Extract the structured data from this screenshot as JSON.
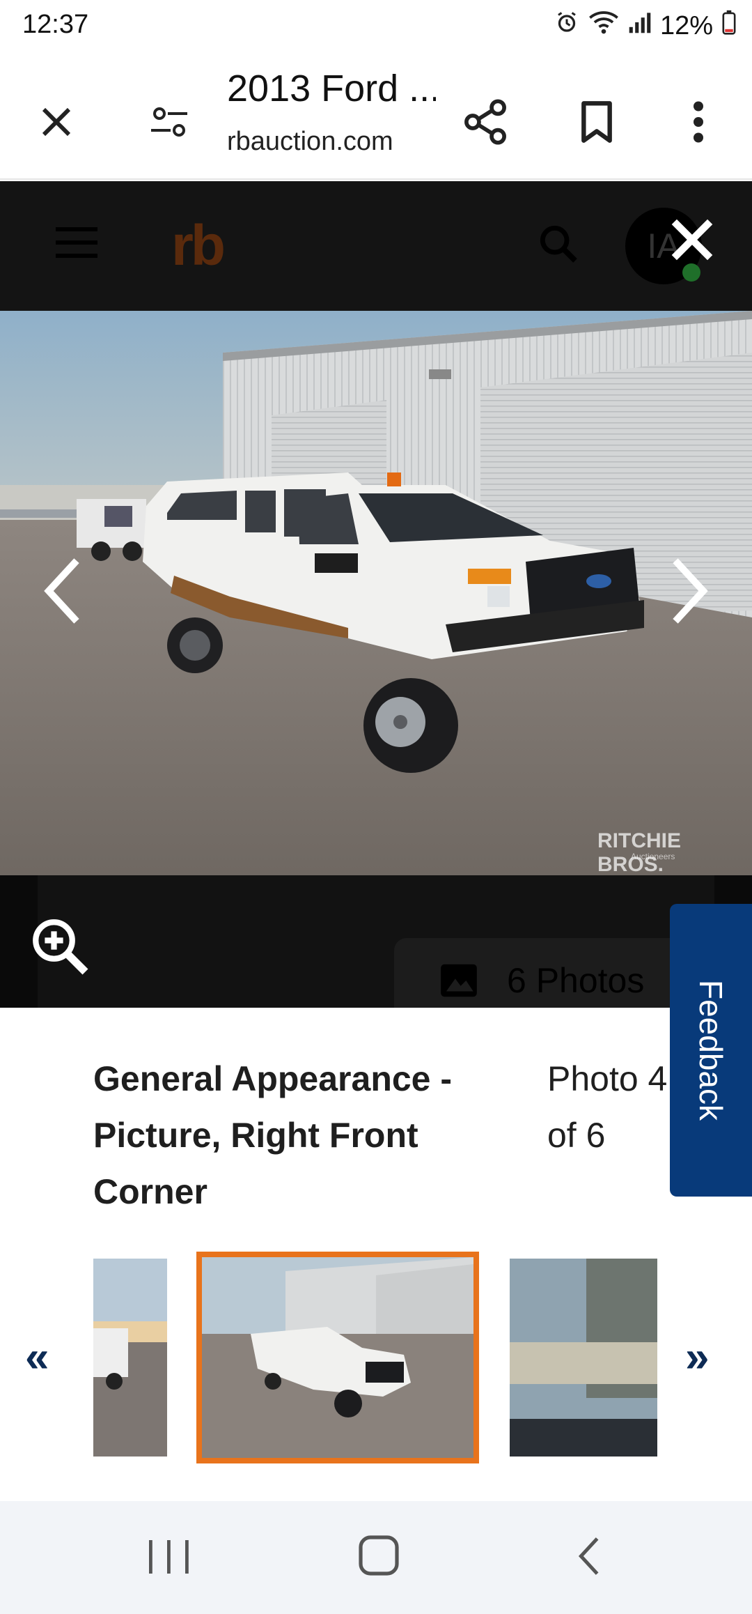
{
  "status_bar": {
    "time": "12:37",
    "battery": "12%",
    "icons": [
      "alarm-icon",
      "wifi-icon",
      "signal-icon",
      "battery-icon"
    ]
  },
  "browser": {
    "title": "2013 Ford ...",
    "url": "rbauction.com",
    "icons": [
      "close-icon",
      "site-settings-icon",
      "share-icon",
      "bookmark-icon",
      "more-vert-icon"
    ]
  },
  "site_header": {
    "logo": "rb",
    "avatar_initials": "IA",
    "icons": [
      "menu-icon",
      "search-icon",
      "close-icon"
    ]
  },
  "viewer": {
    "watermark": "RITCHIE BROS.",
    "watermark_sub": "Auctioneers",
    "photos_badge": "6 Photos",
    "icons": [
      "chevron-left-icon",
      "chevron-right-icon",
      "zoom-in-icon",
      "image-icon"
    ]
  },
  "caption": {
    "text": "General Appearance - Picture, Right Front Corner",
    "photo_count": "Photo 4 of 6"
  },
  "feedback": {
    "label": "Feedback"
  },
  "thumbnails": {
    "prev_label": "«",
    "next_label": "»",
    "selected_index": 1,
    "count_visible": 3
  },
  "colors": {
    "header_bg": "#141414",
    "logo": "#5a2a0c",
    "feedback_bg": "#083a7a",
    "thumb_selected_border": "#e8731c"
  },
  "nav_bar": {
    "icons": [
      "recent-apps-icon",
      "home-icon",
      "back-icon"
    ]
  }
}
